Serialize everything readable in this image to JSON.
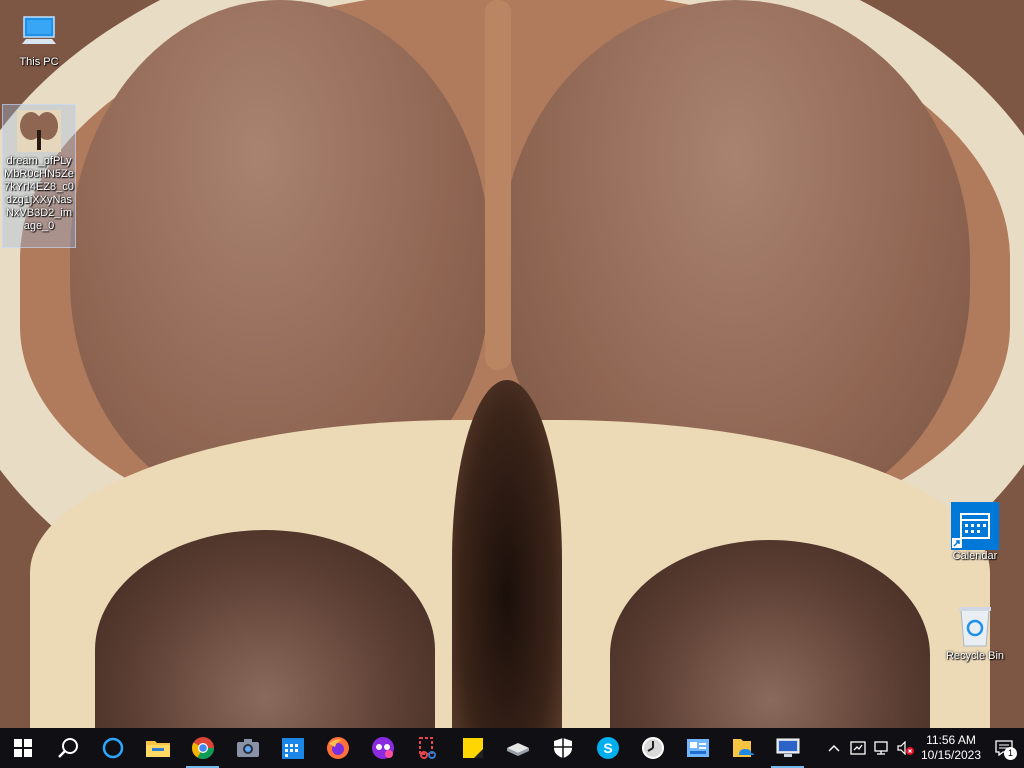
{
  "desktop": {
    "icons": [
      {
        "name": "this-pc",
        "label": "This PC"
      },
      {
        "name": "image-file",
        "label": "dream_pfPLyMbR0cHN5Ze7kYrI4EZ8_c0dzg1jXXyNasNxVB3D2_image_0"
      },
      {
        "name": "calendar",
        "label": "Calendar"
      },
      {
        "name": "recycle-bin",
        "label": "Recycle Bin"
      }
    ]
  },
  "taskbar": {
    "apps": [
      "start-icon",
      "search-icon",
      "cortana-icon",
      "file-explorer-icon",
      "chrome-icon",
      "camera-icon",
      "calendar-icon",
      "firefox-icon",
      "media-player-icon",
      "snipping-tool-icon",
      "sticky-notes-icon",
      "stack-icon",
      "shield-icon",
      "skype-icon",
      "clock-icon",
      "control-panel-icon",
      "onedrive-icon",
      "remote-desktop-icon"
    ],
    "clock": {
      "time": "11:56 AM",
      "date": "10/15/2023"
    },
    "notification_count": "1"
  },
  "colors": {
    "taskbar": "#101014",
    "accent": "#0078d7",
    "active_indicator": "#76b9ed"
  }
}
